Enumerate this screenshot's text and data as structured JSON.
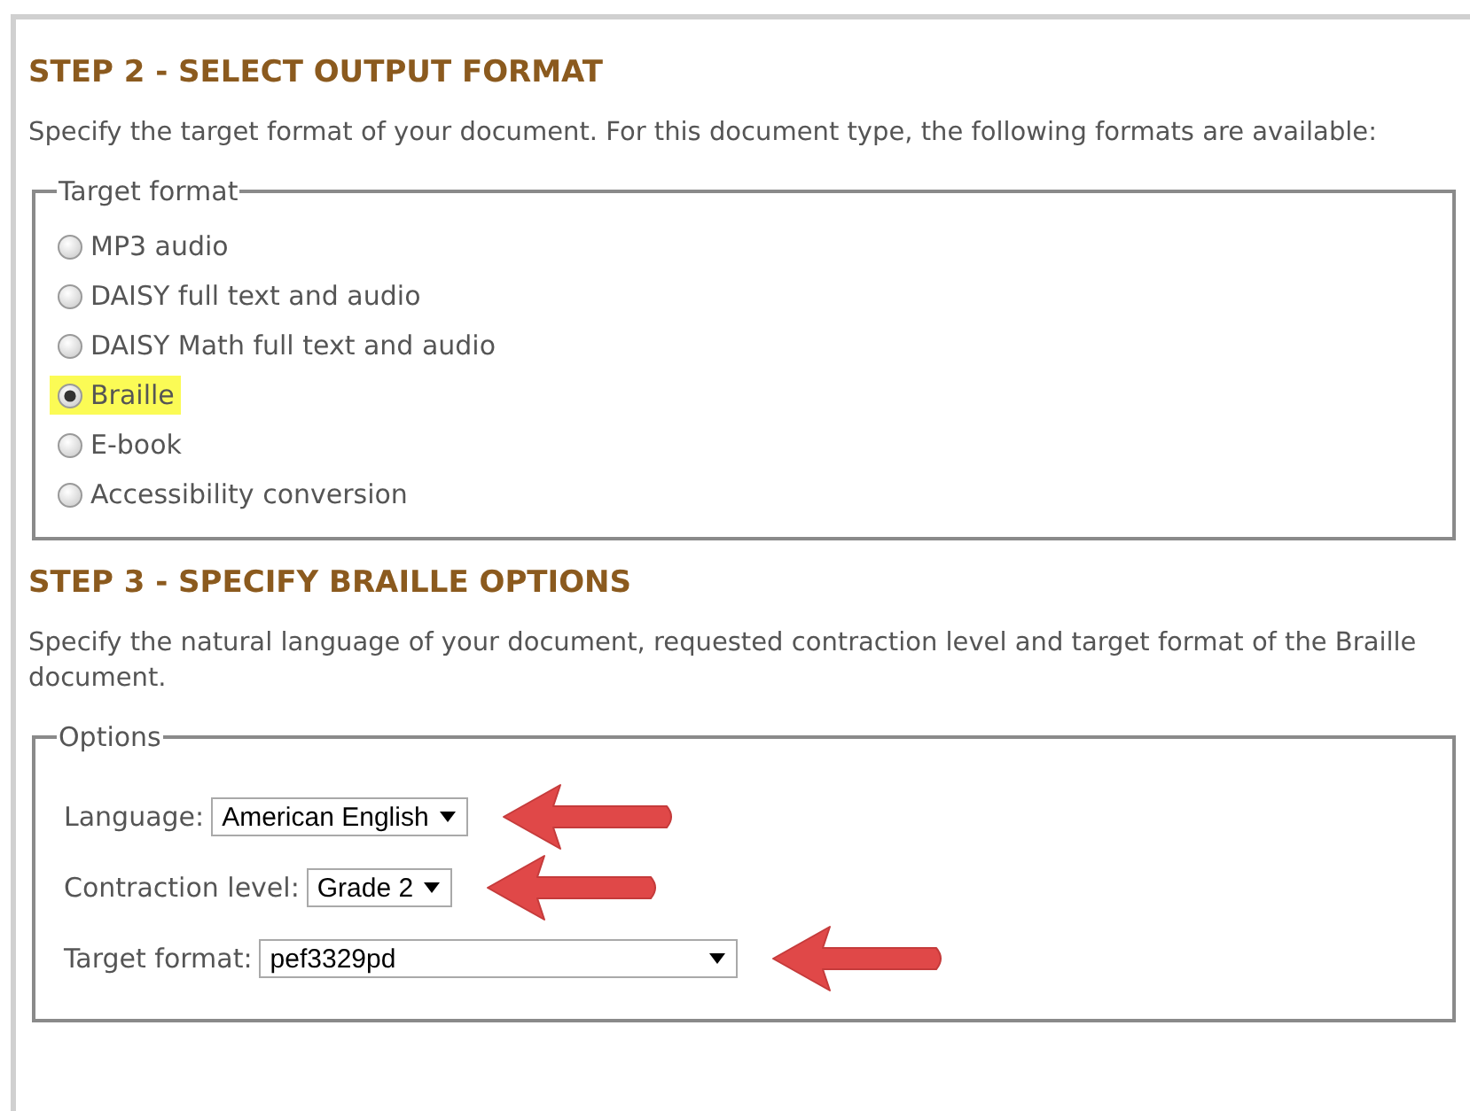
{
  "steps": [
    {
      "heading": "STEP 2 - SELECT OUTPUT FORMAT",
      "text": "Specify the target format of your document. For this document type, the following formats are available:",
      "group": {
        "legend": "Target format",
        "kind": "radios",
        "options": [
          {
            "label": "MP3 audio",
            "selected": false,
            "highlighted": false
          },
          {
            "label": "DAISY full text and audio",
            "selected": false,
            "highlighted": false
          },
          {
            "label": "DAISY Math full text and audio",
            "selected": false,
            "highlighted": false
          },
          {
            "label": "Braille",
            "selected": true,
            "highlighted": true
          },
          {
            "label": "E-book",
            "selected": false,
            "highlighted": false
          },
          {
            "label": "Accessibility conversion",
            "selected": false,
            "highlighted": false
          }
        ]
      }
    },
    {
      "heading": "STEP 3 - SPECIFY BRAILLE OPTIONS",
      "text": "Specify the natural language of your document, requested contraction level and target format of the Braille document.",
      "group": {
        "legend": "Options",
        "kind": "selects",
        "options": [
          {
            "label": "Language:",
            "value": "American English",
            "wide": false,
            "arrow": true
          },
          {
            "label": "Contraction level:",
            "value": "Grade 2",
            "wide": false,
            "arrow": true
          },
          {
            "label": "Target format:",
            "value": "pef3329pd",
            "wide": true,
            "arrow": true
          }
        ]
      }
    }
  ]
}
